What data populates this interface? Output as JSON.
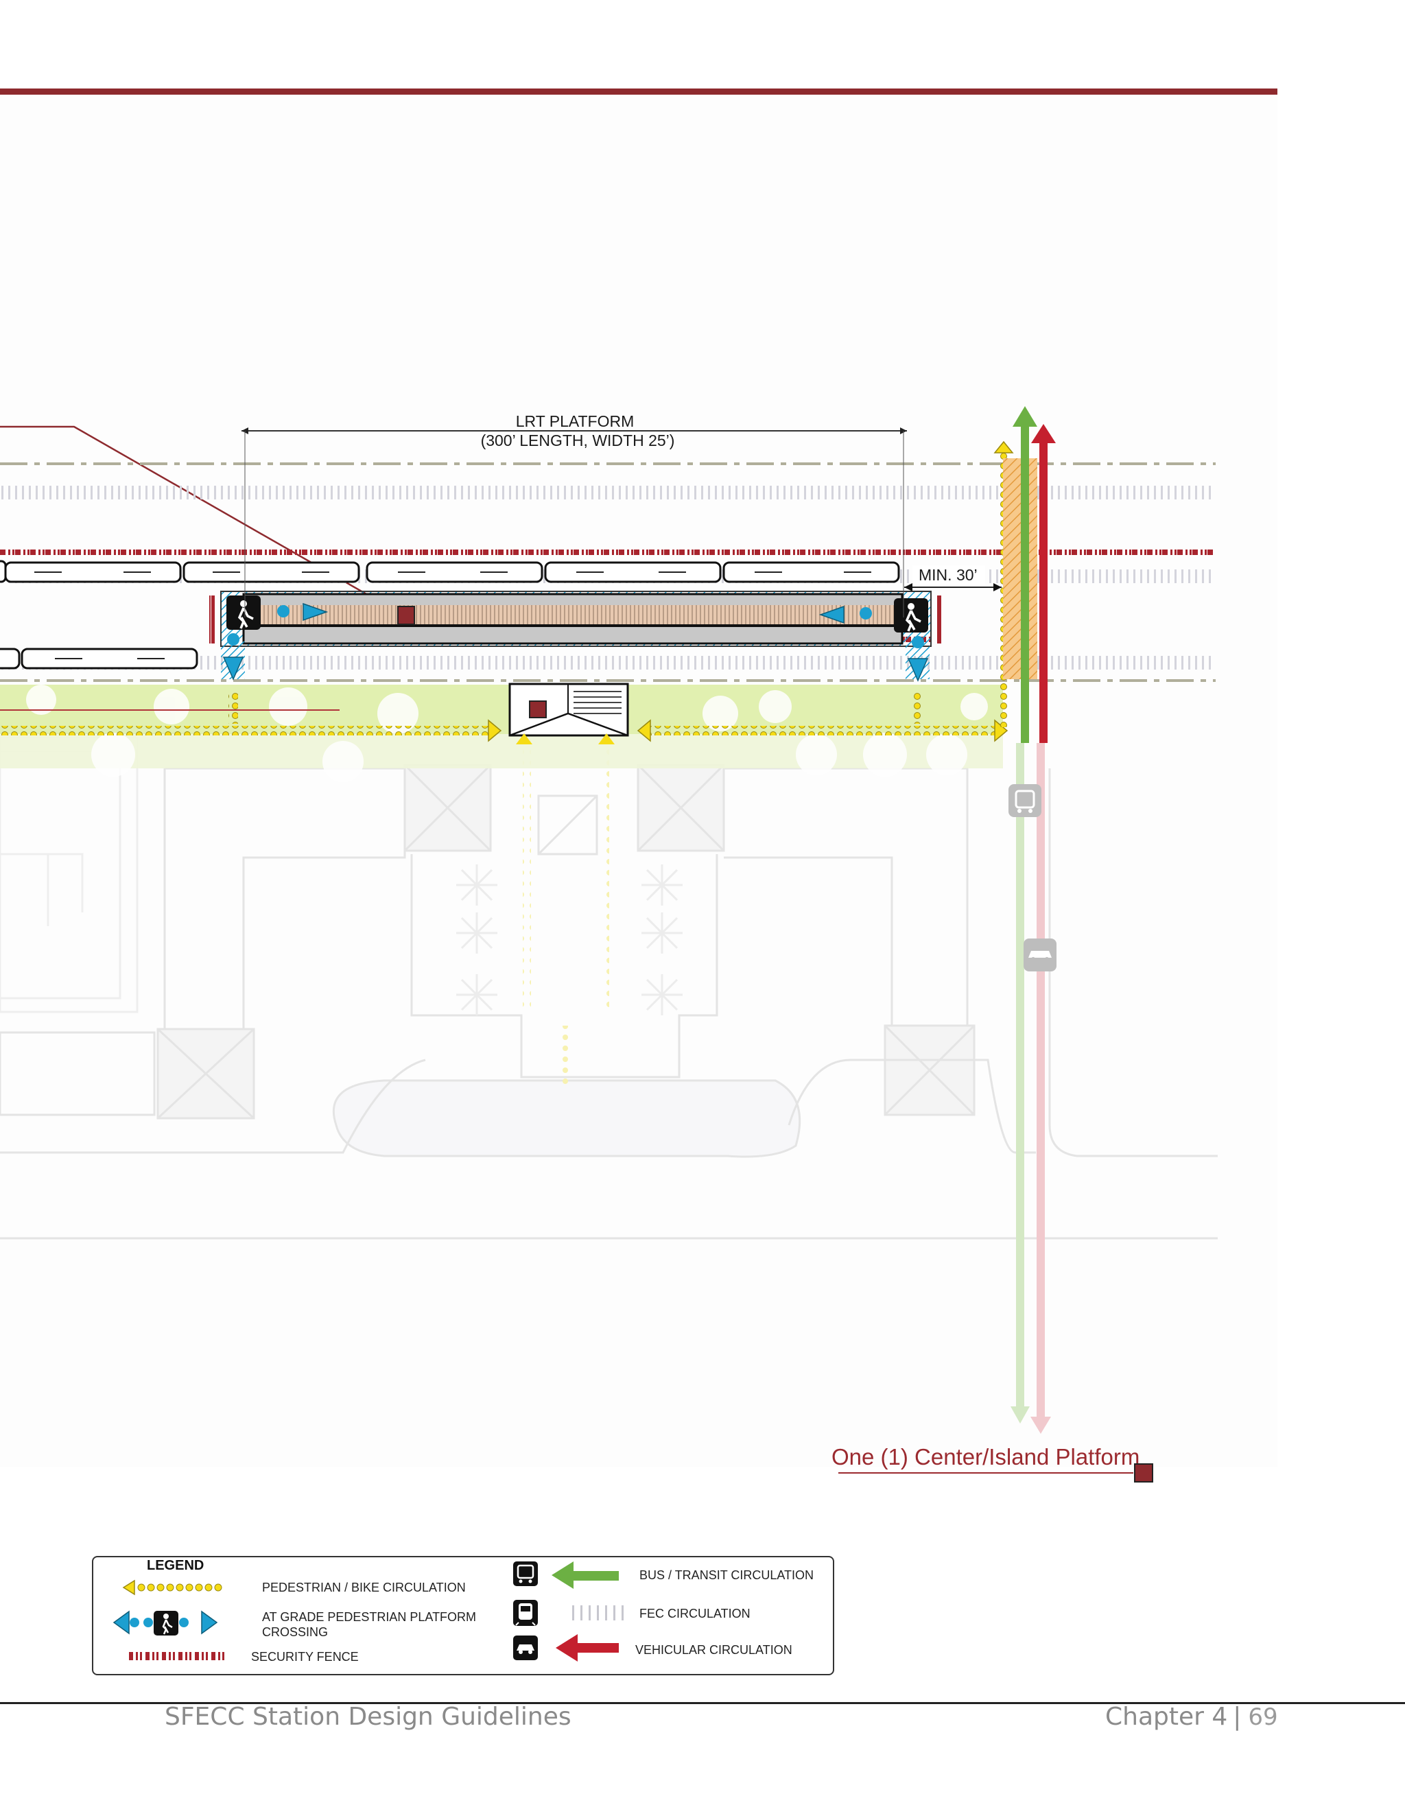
{
  "diagram": {
    "platform_dimension_line1": "LRT PLATFORM",
    "platform_dimension_line2": "(300’ LENGTH, WIDTH 25’)",
    "setback_label": "MIN. 30’",
    "platform_type_label": "One (1) Center/Island Platform"
  },
  "legend": {
    "title": "LEGEND",
    "items": {
      "pedestrian": "PEDESTRIAN  / BIKE CIRCULATION",
      "crossing_line1": "AT GRADE PEDESTRIAN PLATFORM",
      "crossing_line2": "CROSSING",
      "fence": "SECURITY FENCE",
      "bus": "BUS / TRANSIT CIRCULATION",
      "fec": "FEC CIRCULATION",
      "vehicular": "VEHICULAR  CIRCULATION"
    },
    "icons": [
      "bus-icon",
      "train-icon",
      "car-icon",
      "pedestrian-icon"
    ]
  },
  "colors": {
    "brand_red": "#8e2a2e",
    "bus_green": "#6cb043",
    "vehicle_red": "#c4202e",
    "pedestrian_yellow": "#f6dc16",
    "crossing_blue": "#1c9fd0",
    "landscape_green": "#d9ec9c"
  },
  "footer": {
    "document_title": "SFECC Station Design Guidelines",
    "chapter": "Chapter 4",
    "separator": "|",
    "page_number": "69"
  }
}
